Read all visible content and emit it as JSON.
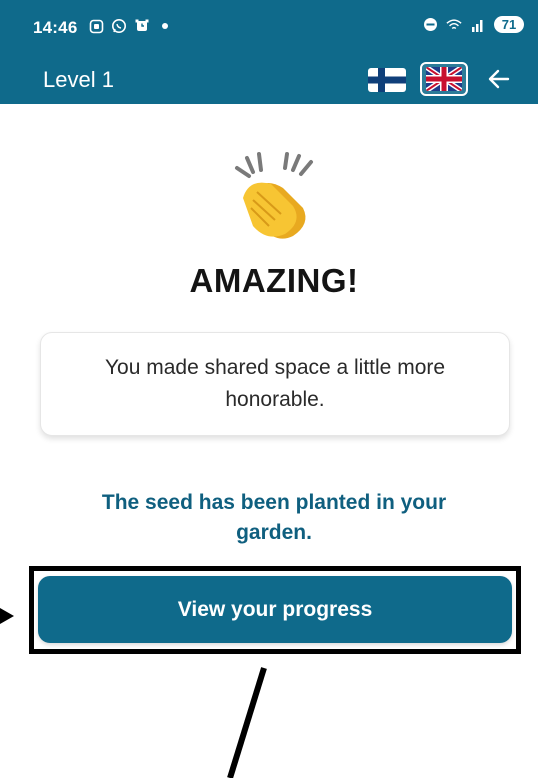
{
  "status_bar": {
    "time": "14:46",
    "battery": "71",
    "left_icons": [
      "screenshot-icon",
      "whatsapp-icon",
      "alarm-icon",
      "dot-icon"
    ],
    "right_icons": [
      "dnd-icon",
      "wifi-icon",
      "signal-icon"
    ]
  },
  "app_bar": {
    "title": "Level 1",
    "languages": [
      "finnish-flag-icon",
      "uk-flag-icon"
    ],
    "back_icon": "back-arrow-icon"
  },
  "main": {
    "celebration_icon": "clapping-hands-icon",
    "heading": "AMAZING!",
    "message": "You made shared space a little more honorable.",
    "seed_note": "The seed has been planted in your garden.",
    "progress_button_label": "View your progress"
  },
  "colors": {
    "primary": "#0f6a8b",
    "seed_text": "#0f5f7f",
    "annotation": "#000000"
  }
}
